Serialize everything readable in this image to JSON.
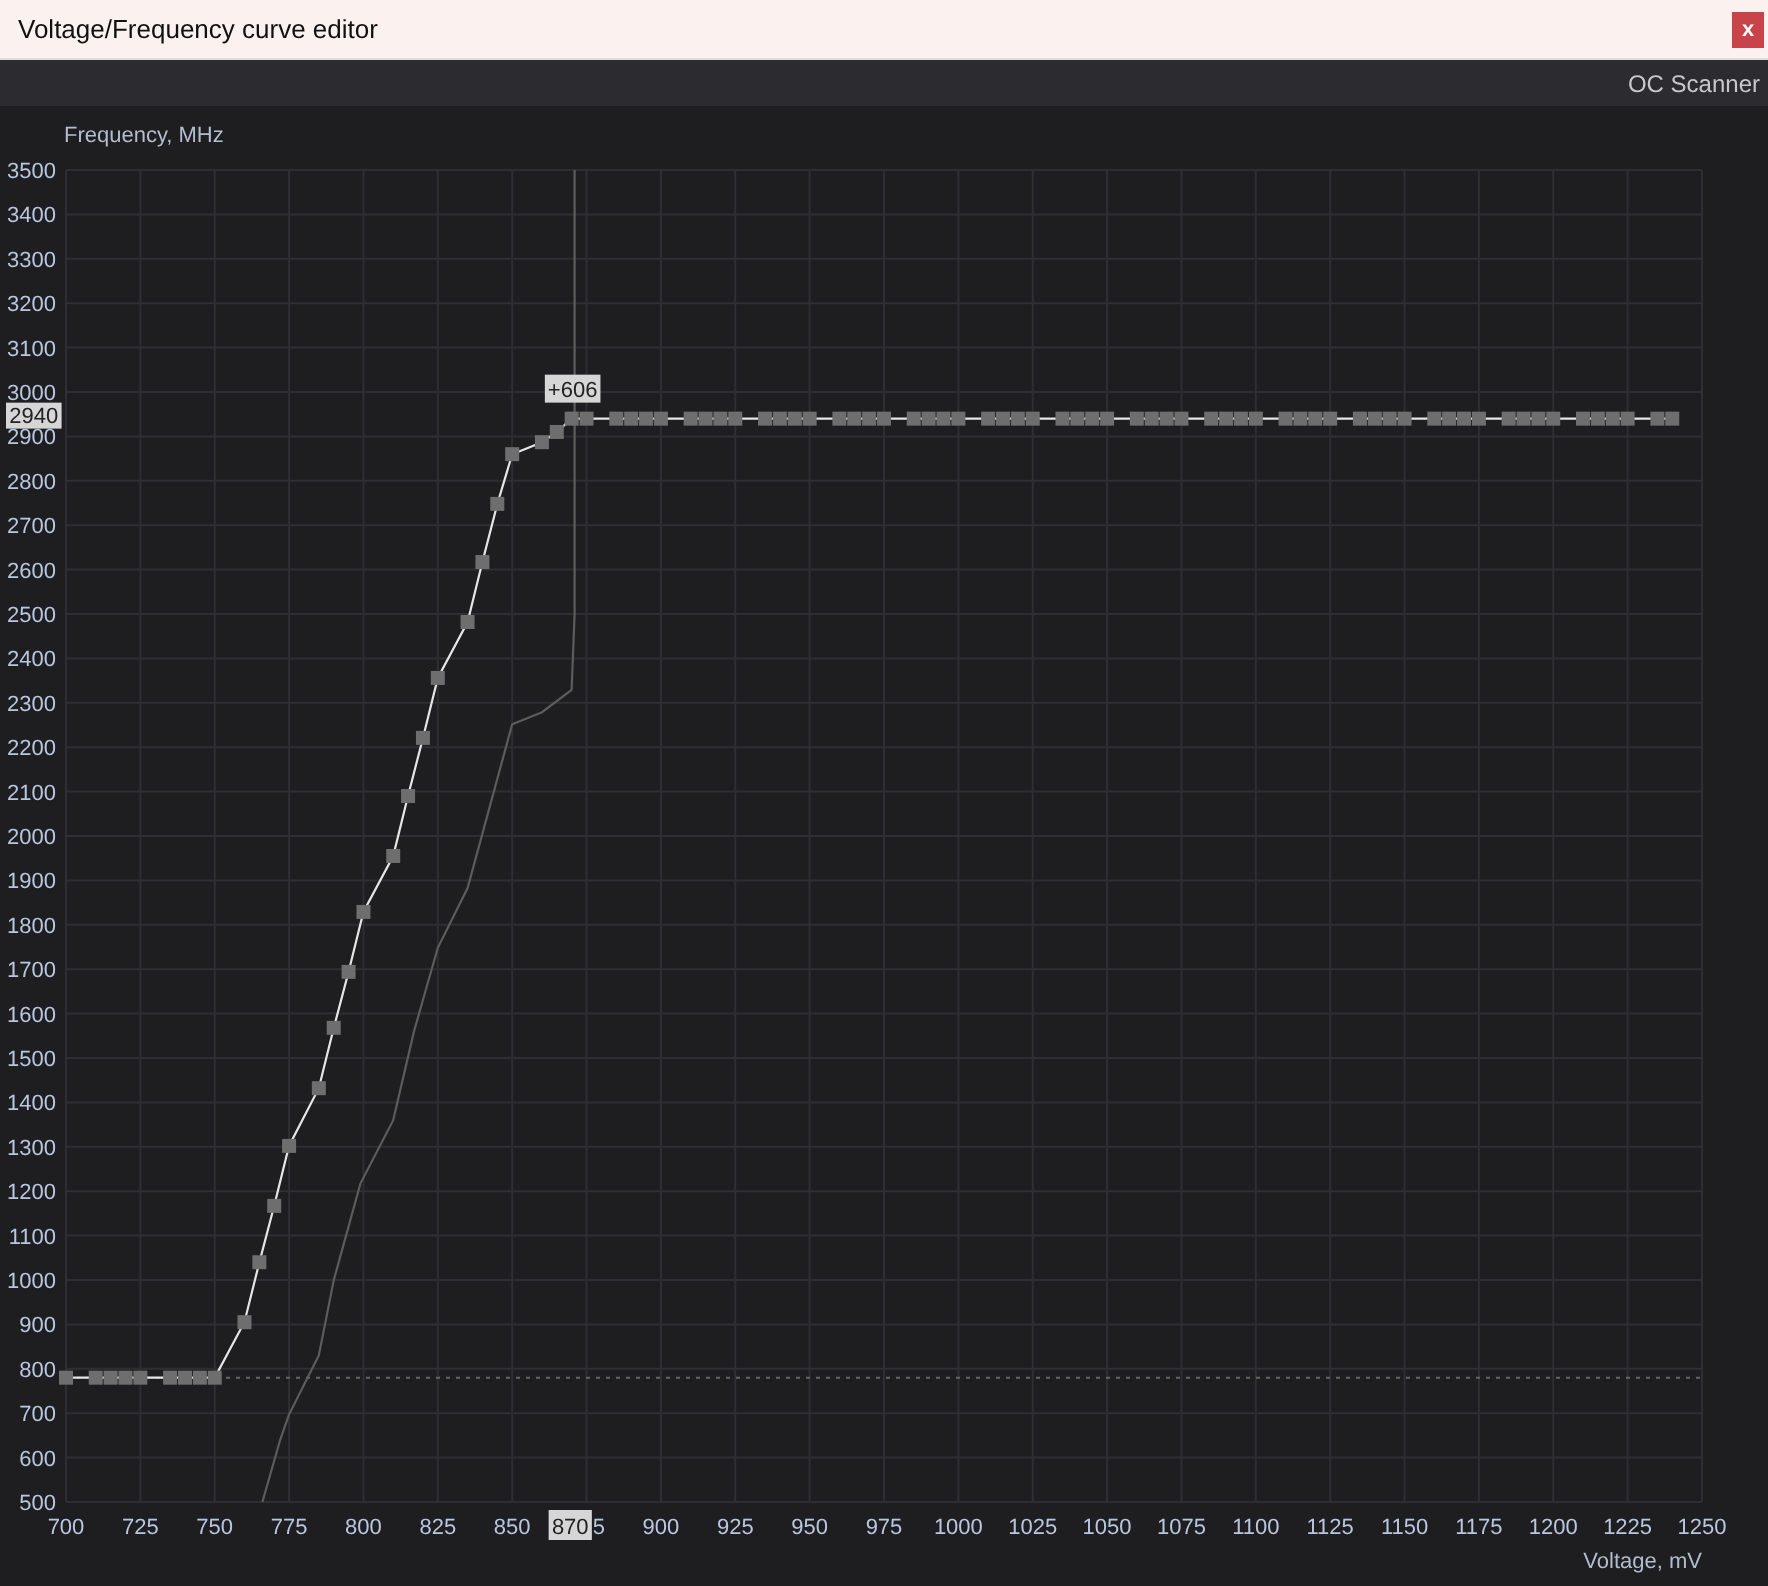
{
  "window": {
    "title": "Voltage/Frequency curve editor",
    "close": "x"
  },
  "toolbar": {
    "button": "OC Scanner"
  },
  "chart_data": {
    "type": "line",
    "xlabel": "Voltage, mV",
    "ylabel": "Frequency, MHz",
    "xlim": [
      700,
      1250
    ],
    "ylim": [
      500,
      3500
    ],
    "grid": true,
    "xticks": [
      700,
      725,
      750,
      775,
      800,
      825,
      850,
      900,
      925,
      950,
      975,
      1000,
      1025,
      1050,
      1075,
      1100,
      1125,
      1150,
      1175,
      1200,
      1225,
      1250
    ],
    "yticks": [
      500,
      600,
      700,
      800,
      900,
      1000,
      1100,
      1200,
      1300,
      1400,
      1500,
      1600,
      1700,
      1800,
      1900,
      2000,
      2100,
      2200,
      2300,
      2400,
      2500,
      2600,
      2700,
      2800,
      2900,
      3000,
      3100,
      3200,
      3300,
      3400,
      3500
    ],
    "series": [
      {
        "marker": true,
        "color": "#e6e6e6",
        "x": [
          700,
          710,
          715,
          720,
          725,
          735,
          740,
          745,
          750,
          760,
          765,
          770,
          775,
          785,
          790,
          795,
          800,
          810,
          815,
          820,
          825,
          835,
          840,
          845,
          850,
          860,
          865,
          870,
          875,
          885,
          890,
          895,
          900,
          910,
          915,
          920,
          925,
          935,
          940,
          945,
          950,
          960,
          965,
          970,
          975,
          985,
          990,
          995,
          1000,
          1010,
          1015,
          1020,
          1025,
          1035,
          1040,
          1045,
          1050,
          1060,
          1065,
          1070,
          1075,
          1085,
          1090,
          1095,
          1100,
          1110,
          1115,
          1120,
          1125,
          1135,
          1140,
          1145,
          1150,
          1160,
          1165,
          1170,
          1175,
          1185,
          1190,
          1195,
          1200,
          1210,
          1215,
          1220,
          1225,
          1235,
          1240
        ],
        "values": [
          780,
          780,
          780,
          780,
          780,
          780,
          780,
          780,
          780,
          905,
          1040,
          1167,
          1302,
          1432,
          1568,
          1694,
          1829,
          1955,
          2090,
          2221,
          2356,
          2482,
          2617,
          2748,
          2860,
          2887,
          2910,
          2940,
          2940,
          2940,
          2940,
          2940,
          2940,
          2940,
          2940,
          2940,
          2940,
          2940,
          2940,
          2940,
          2940,
          2940,
          2940,
          2940,
          2940,
          2940,
          2940,
          2940,
          2940,
          2940,
          2940,
          2940,
          2940,
          2940,
          2940,
          2940,
          2940,
          2940,
          2940,
          2940,
          2940,
          2940,
          2940,
          2940,
          2940,
          2940,
          2940,
          2940,
          2940,
          2940,
          2940,
          2940,
          2940,
          2940,
          2940,
          2940,
          2940,
          2940,
          2940,
          2940,
          2940,
          2940,
          2940,
          2940,
          2940,
          2940,
          2940
        ]
      },
      {
        "marker": false,
        "color": "#5c5c5c",
        "x": [
          766,
          772,
          775,
          785,
          790,
          799,
          810,
          817,
          825,
          835,
          850,
          860,
          870,
          871,
          871
        ],
        "values": [
          500,
          640,
          697,
          830,
          1000,
          1217,
          1360,
          1560,
          1748,
          1883,
          2252,
          2279,
          2329,
          2500,
          3500
        ]
      }
    ],
    "ref_lines": [
      {
        "axis": "y",
        "value": 780
      }
    ]
  },
  "cursor": {
    "offset": "+606",
    "frequency": "2940",
    "voltage": "870",
    "covered_tick": "5"
  }
}
